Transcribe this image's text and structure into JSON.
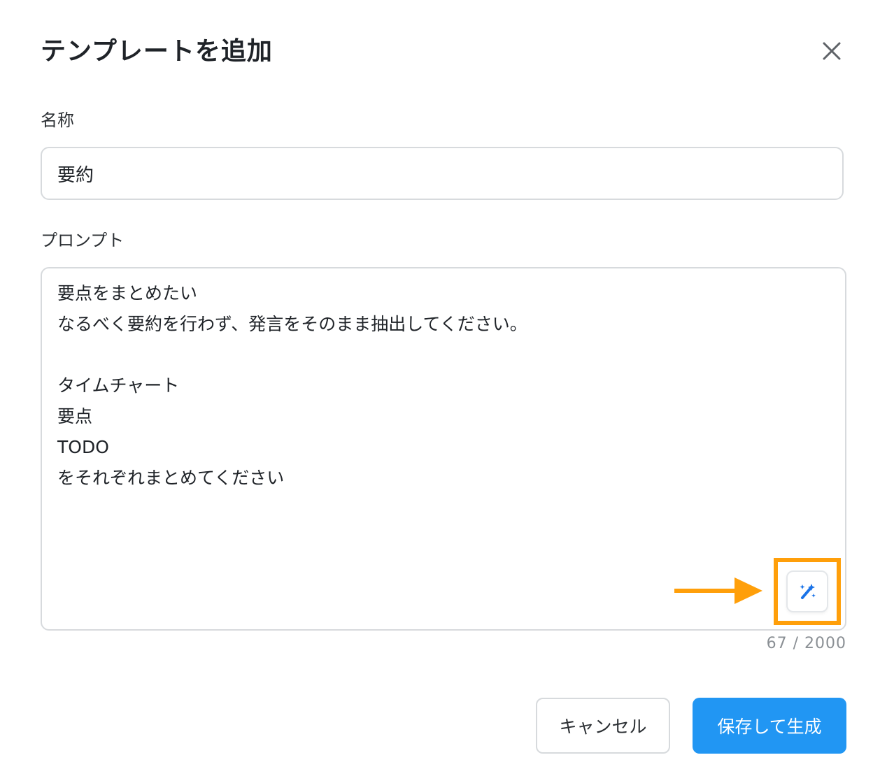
{
  "dialog": {
    "title": "テンプレートを追加",
    "close_icon": "close-icon"
  },
  "form": {
    "name_label": "名称",
    "name_value": "要約",
    "prompt_label": "プロンプト",
    "prompt_value": "要点をまとめたい\nなるべく要約を行わず、発言をそのまま抽出してください。\n\nタイムチャート\n要点\nTODO\nをそれぞれまとめてください",
    "magic_icon": "magic-wand-icon",
    "char_count": "67 / 2000"
  },
  "buttons": {
    "cancel_label": "キャンセル",
    "primary_label": "保存して生成"
  },
  "colors": {
    "accent": "#2196f3",
    "highlight": "#ff9f0a",
    "border": "#d7dadd"
  }
}
